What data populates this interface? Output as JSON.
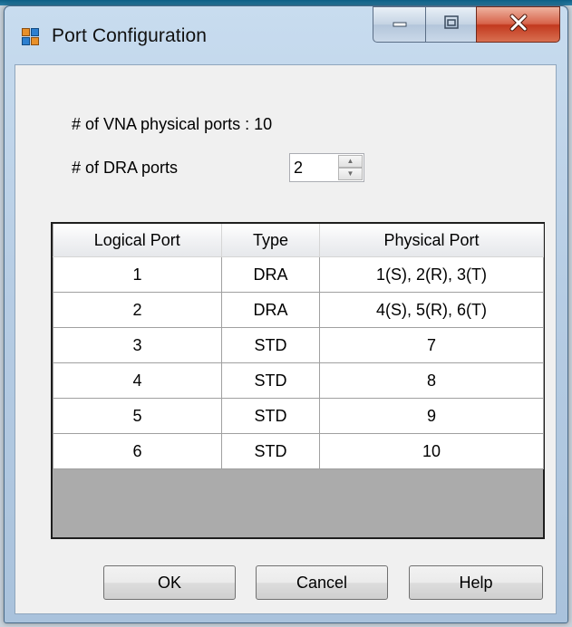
{
  "window": {
    "title": "Port Configuration",
    "icon": "app-window-icon",
    "controls": {
      "minimize": "minimize-icon",
      "maximize": "maximize-icon",
      "close": "close-icon"
    }
  },
  "config": {
    "vna_ports_label": "# of VNA physical ports : 10",
    "dra_ports_label": "# of DRA ports",
    "dra_ports_value": "2"
  },
  "table": {
    "headers": [
      "Logical Port",
      "Type",
      "Physical Port"
    ],
    "rows": [
      [
        "1",
        "DRA",
        "1(S), 2(R), 3(T)"
      ],
      [
        "2",
        "DRA",
        "4(S), 5(R), 6(T)"
      ],
      [
        "3",
        "STD",
        "7"
      ],
      [
        "4",
        "STD",
        "8"
      ],
      [
        "5",
        "STD",
        "9"
      ],
      [
        "6",
        "STD",
        "10"
      ]
    ]
  },
  "buttons": {
    "ok": "OK",
    "cancel": "Cancel",
    "help": "Help"
  },
  "colors": {
    "close_button": "#c2391e",
    "grid_empty_area": "#ababab",
    "client_bg": "#f0f0f0"
  }
}
